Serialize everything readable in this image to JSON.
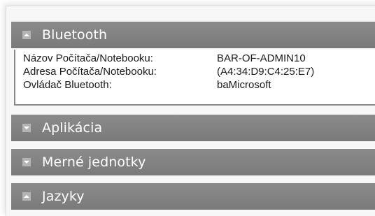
{
  "sections": [
    {
      "label": "Bluetooth",
      "expanded": true,
      "icon": "chevron-up-icon"
    },
    {
      "label": "Aplikácia",
      "expanded": false,
      "icon": "chevron-down-icon"
    },
    {
      "label": "Merné jednotky",
      "expanded": false,
      "icon": "chevron-down-icon"
    },
    {
      "label": "Jazyky",
      "expanded": true,
      "icon": "chevron-up-icon"
    }
  ],
  "bluetooth_details": [
    {
      "label": "Názov Počítača/Notebooku:",
      "value": "BAR-OF-ADMIN10"
    },
    {
      "label": "Adresa Počítača/Notebooku:",
      "value": "(A4:34:D9:C4:25:E7)"
    },
    {
      "label": "Ovládač Bluetooth:",
      "value": "baMicrosoft"
    }
  ],
  "colors": {
    "header_bg": "#7f7f7f",
    "header_text": "#ffffff",
    "toggle_bg": "#b4b4b4",
    "border": "#8a8a8a"
  }
}
